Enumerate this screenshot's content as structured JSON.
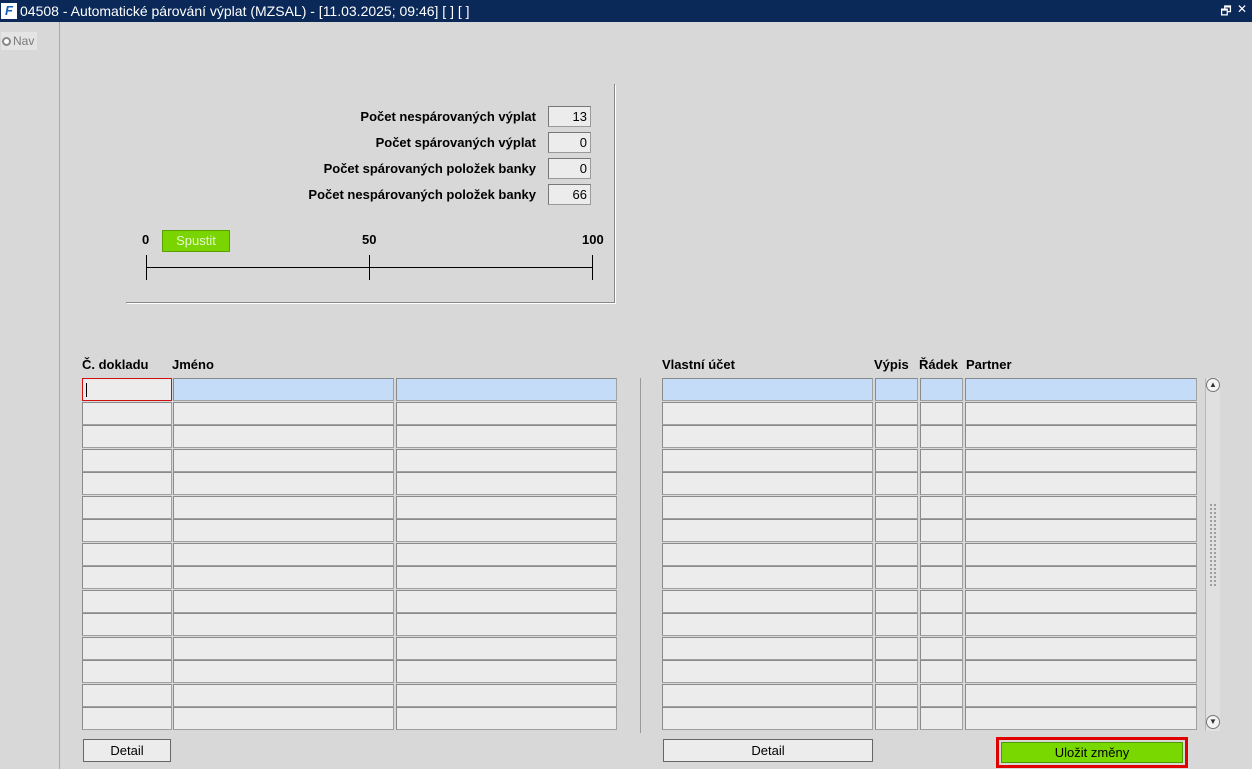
{
  "window": {
    "title": "04508 - Automatické párování výplat (MZSAL) - [11.03.2025; 09:46]  [ ]  [ ]",
    "app_icon_glyph": "F",
    "restore_glyph": "🗗",
    "close_glyph": "✕"
  },
  "navigator": {
    "label": "Nav"
  },
  "stats": [
    {
      "label": "Počet nespárovaných výplat",
      "value": "13"
    },
    {
      "label": "Počet spárovaných výplat",
      "value": "0"
    },
    {
      "label": "Počet spárovaných položek banky",
      "value": "0"
    },
    {
      "label": "Počet nespárovaných položek banky",
      "value": "66"
    }
  ],
  "progress": {
    "min_label": "0",
    "mid_label": "50",
    "max_label": "100",
    "value_percent": 0,
    "run_button": "Spustit"
  },
  "left_table": {
    "headers": [
      "Č. dokladu",
      "Jméno"
    ],
    "rows": 15,
    "detail_button": "Detail"
  },
  "right_table": {
    "headers": [
      "Vlastní účet",
      "Výpis",
      "Řádek",
      "Partner"
    ],
    "rows": 15,
    "detail_button": "Detail"
  },
  "save_button": "Uložit změny",
  "colors": {
    "titlebar": "#0a2858",
    "selected_row": "#c4dcf8",
    "accent_green": "#78d800",
    "focus_red": "#e00000"
  }
}
